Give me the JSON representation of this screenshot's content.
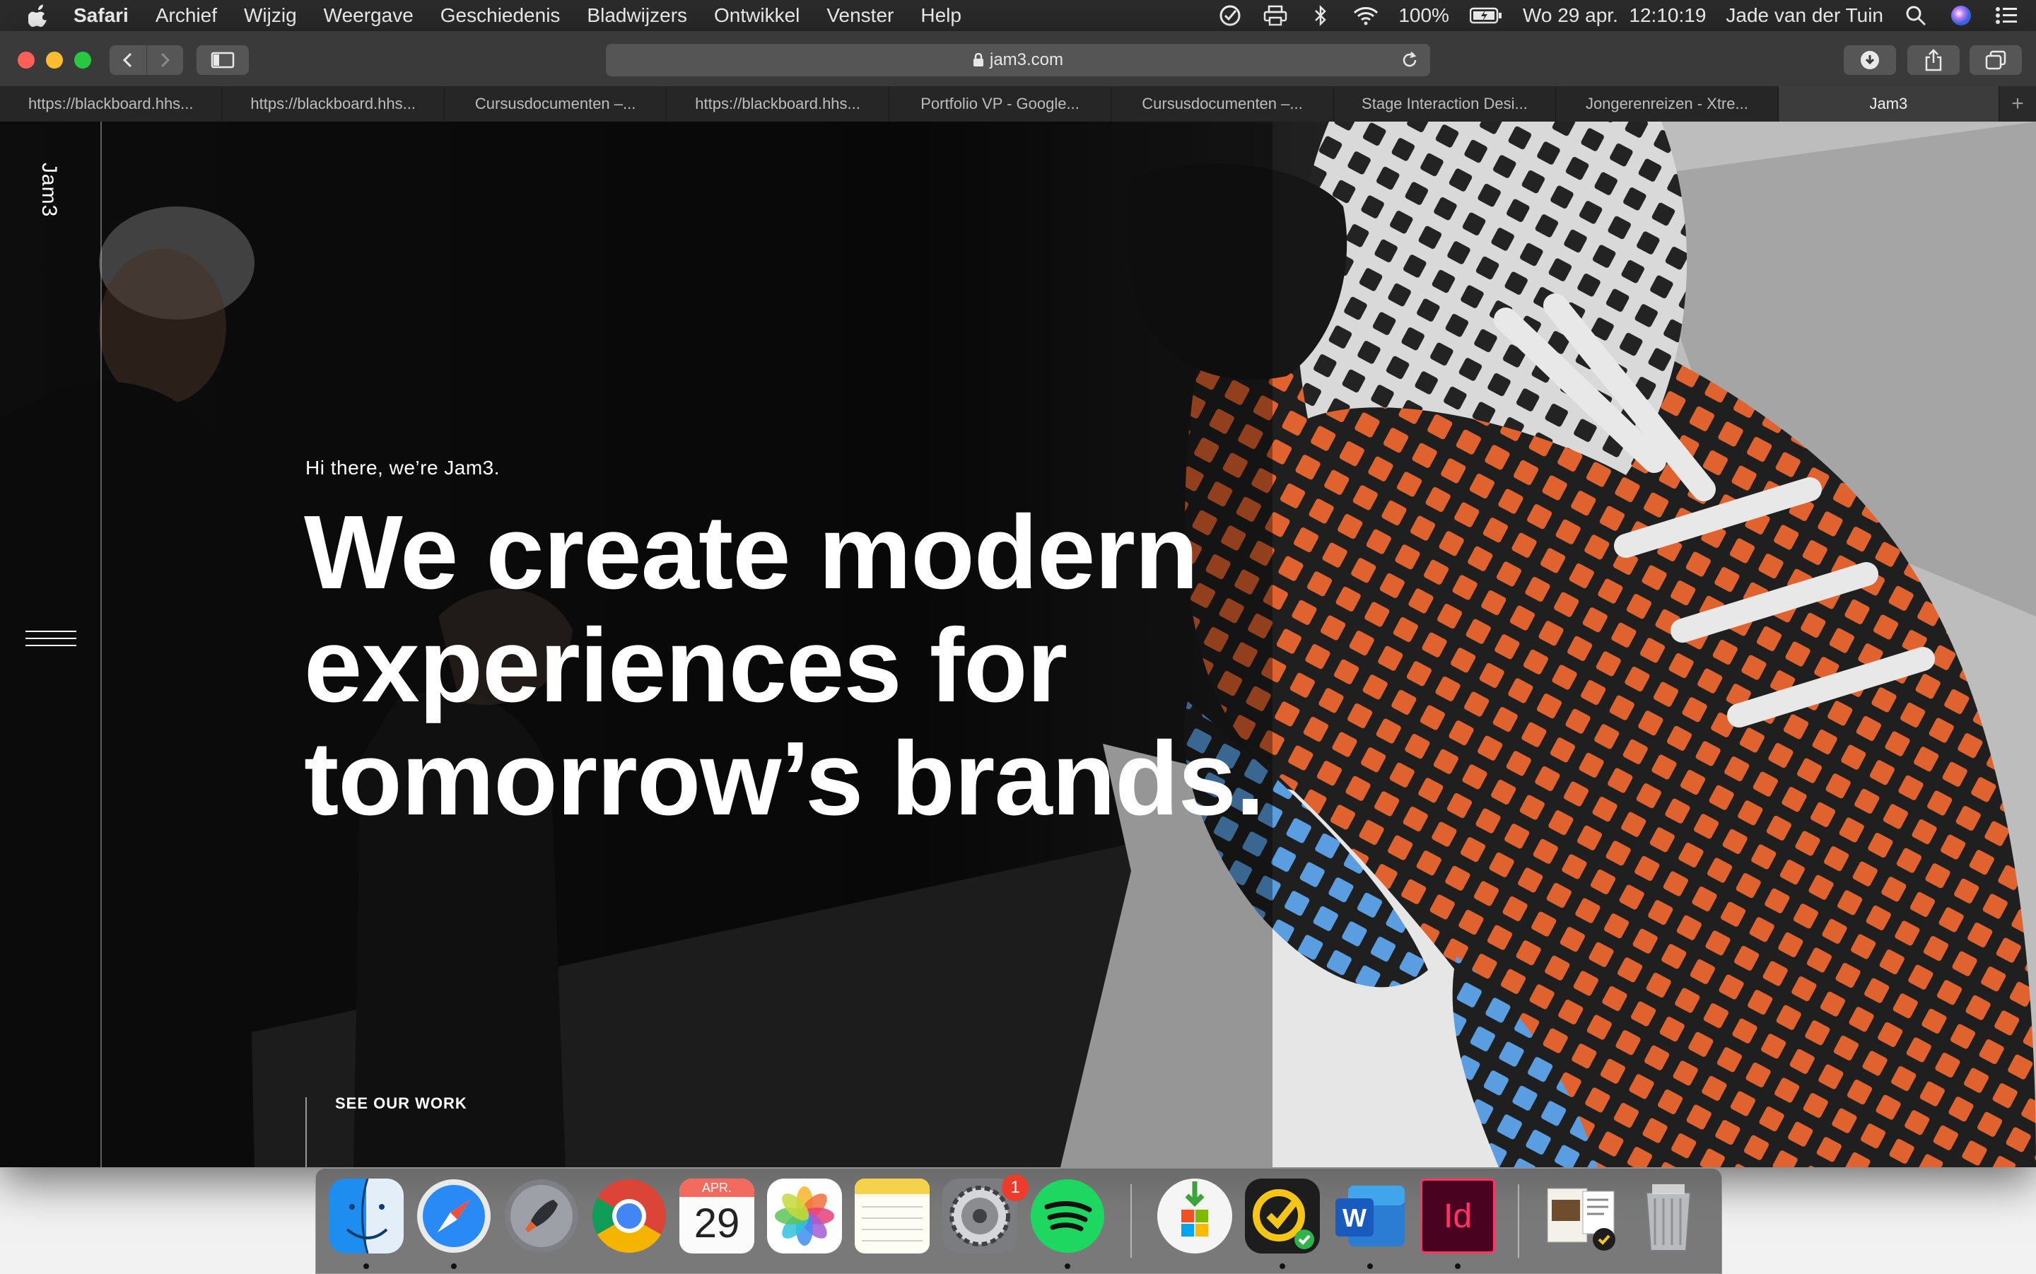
{
  "menubar": {
    "app": "Safari",
    "items": [
      "Archief",
      "Wijzig",
      "Weergave",
      "Geschiedenis",
      "Bladwijzers",
      "Ontwikkel",
      "Venster",
      "Help"
    ],
    "battery": "100%",
    "datetime": "Wo 29 apr.  12:10:19",
    "user": "Jade van der Tuin"
  },
  "browser": {
    "url": "jam3.com",
    "tabs": [
      {
        "label": "https://blackboard.hhs..."
      },
      {
        "label": "https://blackboard.hhs..."
      },
      {
        "label": "Cursusdocumenten –..."
      },
      {
        "label": "https://blackboard.hhs..."
      },
      {
        "label": "Portfolio VP - Google..."
      },
      {
        "label": "Cursusdocumenten –..."
      },
      {
        "label": "Stage Interaction Desi..."
      },
      {
        "label": "Jongerenreizen - Xtre..."
      },
      {
        "label": "Jam3"
      }
    ],
    "new_tab_symbol": "+"
  },
  "page": {
    "logo": "Jam3",
    "intro": "Hi there, we’re Jam3.",
    "headline": [
      "We create modern",
      "experiences for",
      "tomorrow’s brands."
    ],
    "cta": "SEE OUR WORK"
  },
  "dock": {
    "calendar_month": "APR.",
    "calendar_day": "29",
    "prefs_badge": "1",
    "apps": [
      "finder-icon",
      "safari-icon",
      "launchpad-icon",
      "chrome-icon",
      "calendar-icon",
      "photos-icon",
      "notes-icon",
      "system-preferences-icon",
      "spotify-icon",
      "microsoft-store-icon",
      "norton-icon",
      "word-icon",
      "indesign-icon",
      "stack-icon",
      "trash-icon"
    ]
  },
  "colors": {
    "accent_orange": "#e0622f",
    "mesh_blue": "#5a9de0",
    "menubar_bg": "#2b2b2b"
  }
}
